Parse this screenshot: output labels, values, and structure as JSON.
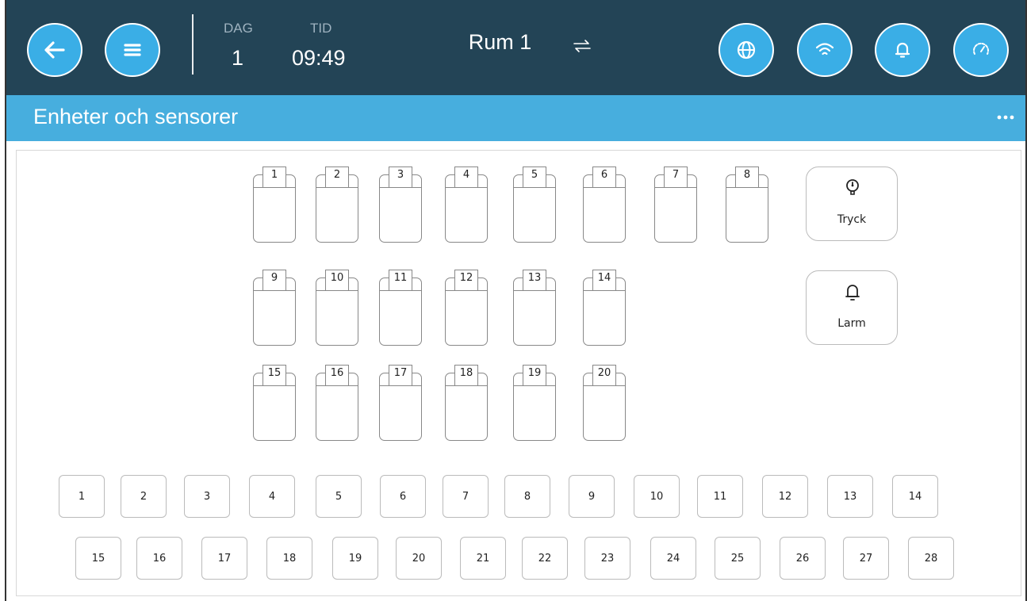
{
  "header": {
    "day_label": "DAG",
    "day_value": "1",
    "time_label": "TID",
    "time_value": "09:49",
    "room": "Rum 1",
    "icons": [
      "back-arrow-icon",
      "menu-icon",
      "globe-icon",
      "wifi-icon",
      "bell-icon",
      "gauge-icon",
      "swap-icon"
    ]
  },
  "subheader": {
    "title": "Enheter och sensorer",
    "more_icon": "more-dots-icon"
  },
  "module_tiles": [
    "1",
    "2",
    "3",
    "4",
    "5",
    "6",
    "7",
    "8",
    "9",
    "10",
    "11",
    "12",
    "13",
    "14",
    "15",
    "16",
    "17",
    "18",
    "19",
    "20"
  ],
  "side_buttons": {
    "pressure": {
      "label": "Tryck",
      "icon": "pressure-gauge-icon"
    },
    "alarm": {
      "label": "Larm",
      "icon": "alarm-bell-icon"
    }
  },
  "channels_row1": [
    "1",
    "2",
    "3",
    "4",
    "5",
    "6",
    "7",
    "8",
    "9",
    "10",
    "11",
    "12",
    "13",
    "14"
  ],
  "channels_row2": [
    "15",
    "16",
    "17",
    "18",
    "19",
    "20",
    "21",
    "22",
    "23",
    "24",
    "25",
    "26",
    "27",
    "28"
  ],
  "colors": {
    "header_bg": "#234456",
    "subheader_bg": "#47aede",
    "button_bg": "#3aaee6"
  }
}
